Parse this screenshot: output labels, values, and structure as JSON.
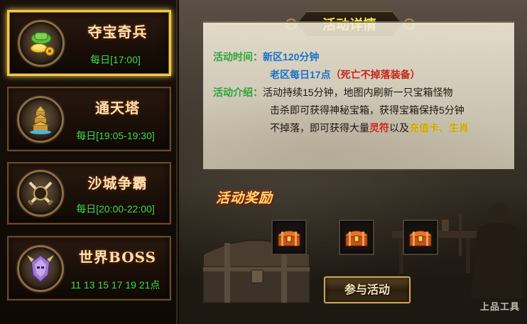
{
  "events": [
    {
      "name": "夺宝奇兵",
      "time": "每日[17:00]",
      "icon": "gold-treasure-icon",
      "selected": true
    },
    {
      "name": "通天塔",
      "time": "每日[19:05-19:30]",
      "icon": "pagoda-icon",
      "selected": false
    },
    {
      "name": "沙城争霸",
      "time": "每日[20:00-22:00]",
      "icon": "crossed-swords-icon",
      "selected": false
    },
    {
      "name": "世界BOSS",
      "time": "11 13 15 17 19 21点",
      "icon": "demon-helm-icon",
      "selected": false
    }
  ],
  "detail": {
    "header": "活动详情",
    "time_label": "活动时间：",
    "time_line1": "新区120分钟",
    "time_line2_a": "老区每日17点",
    "time_line2_b": "（死亡不掉落装备）",
    "intro_label": "活动介绍：",
    "intro_line1": "活动持续15分钟，地图内刷新一只宝箱怪物",
    "intro_line2": "击杀即可获得神秘宝箱，获得宝箱保持5分钟",
    "intro_line3_a": "不掉落，即可获得大量",
    "intro_line3_b": "灵符",
    "intro_line3_c": "以及",
    "intro_line3_d": "充值卡、生肖"
  },
  "rewards": {
    "title": "活动奖励",
    "items": [
      "treasure-chest-icon",
      "treasure-chest-icon",
      "treasure-chest-icon"
    ]
  },
  "join_button": "参与活动",
  "watermark": "上品工具",
  "colors": {
    "accent_gold": "#f1c94a",
    "time_green": "#44e047",
    "label_green": "#2aa53a",
    "value_blue": "#1a72c9",
    "highlight_red": "#d5261e",
    "highlight_yellow": "#c9a300"
  }
}
